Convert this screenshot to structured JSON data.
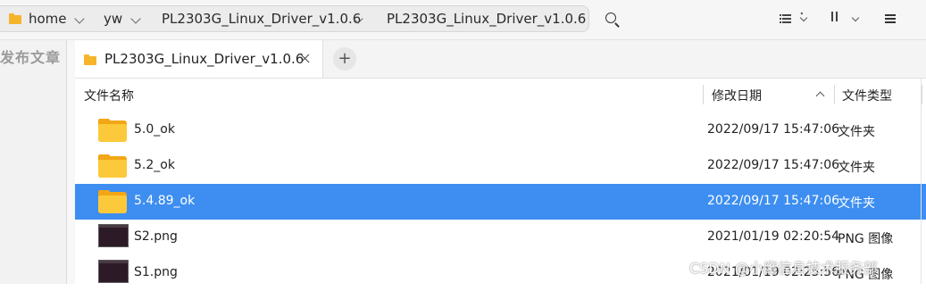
{
  "breadcrumb": {
    "items": [
      {
        "label": "home",
        "icon": "folder-icon"
      },
      {
        "label": "yw"
      },
      {
        "label": "PL2303G_Linux_Driver_v1.0.6"
      },
      {
        "label": "PL2303G_Linux_Driver_v1.0.6"
      }
    ]
  },
  "toolbar": {
    "search_icon": "search-icon",
    "view_icon": "list-view-icon",
    "sort_icon": "sort-icon",
    "menu_icon": "hamburger-menu-icon"
  },
  "left_pane": {
    "text": "发布文章"
  },
  "tabs": [
    {
      "label": "PL2303G_Linux_Driver_v1.0.6",
      "icon": "folder-icon"
    }
  ],
  "new_tab_label": "+",
  "columns": {
    "name": "文件名称",
    "modified": "修改日期",
    "type": "文件类型"
  },
  "files": [
    {
      "name": "5.0_ok",
      "modified": "2022/09/17 15:47:06",
      "type": "文件夹",
      "icon": "folder-icon"
    },
    {
      "name": "5.2_ok",
      "modified": "2022/09/17 15:47:06",
      "type": "文件夹",
      "icon": "folder-icon"
    },
    {
      "name": "5.4.89_ok",
      "modified": "2022/09/17 15:47:06",
      "type": "文件夹",
      "icon": "folder-icon",
      "selected": true
    },
    {
      "name": "S2.png",
      "modified": "2021/01/19 02:20:54",
      "type": "PNG 图像",
      "icon": "image-thumbnail"
    },
    {
      "name": "S1.png",
      "modified": "2021/01/19 02:25:56",
      "type": "PNG 图像",
      "icon": "image-thumbnail"
    }
  ],
  "colors": {
    "selection": "#3d8ef0",
    "folder": "#fcc93b"
  },
  "watermark": "CSDN @小鹰信息技术服务部"
}
